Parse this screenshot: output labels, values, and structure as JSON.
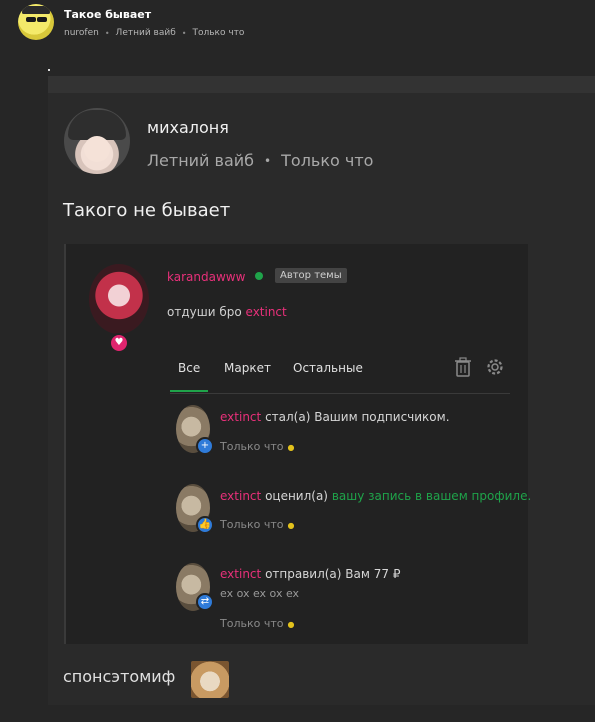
{
  "post": {
    "title": "Такое бывает",
    "author": "nurofen",
    "community": "Летний вайб",
    "time": "Только что",
    "separator": "•",
    "tiny_mark": "."
  },
  "quoted": {
    "author": "михалоня",
    "community": "Летний вайб",
    "time": "Только что",
    "separator": "•",
    "text": "Такого не бывает"
  },
  "screenshot": {
    "username": "karandawww",
    "badge": "Автор темы",
    "status_prefix": "отдуши бро",
    "status_highlight": "extinct",
    "tabs": [
      {
        "label": "Все"
      },
      {
        "label": "Маркет"
      },
      {
        "label": "Остальные"
      }
    ],
    "notifications": [
      {
        "user": "extinct",
        "action": "стал(а) Вашим подписчиком.",
        "extra": "",
        "sub": "",
        "time": "Только что",
        "icon": "plus-icon"
      },
      {
        "user": "extinct",
        "action": "оценил(а)",
        "extra": "вашу запись в вашем профиле.",
        "sub": "",
        "time": "Только что",
        "icon": "like-icon"
      },
      {
        "user": "extinct",
        "action": "отправил(а) Вам 77 ₽",
        "extra": "",
        "sub": "ex ox ex ox ex",
        "time": "Только что",
        "icon": "transfer-icon"
      }
    ],
    "colors": {
      "accent": "#1fa34a",
      "username": "#e8307a",
      "icon_blue": "#2f7bd9"
    }
  },
  "caption": "спонсэтомиф"
}
